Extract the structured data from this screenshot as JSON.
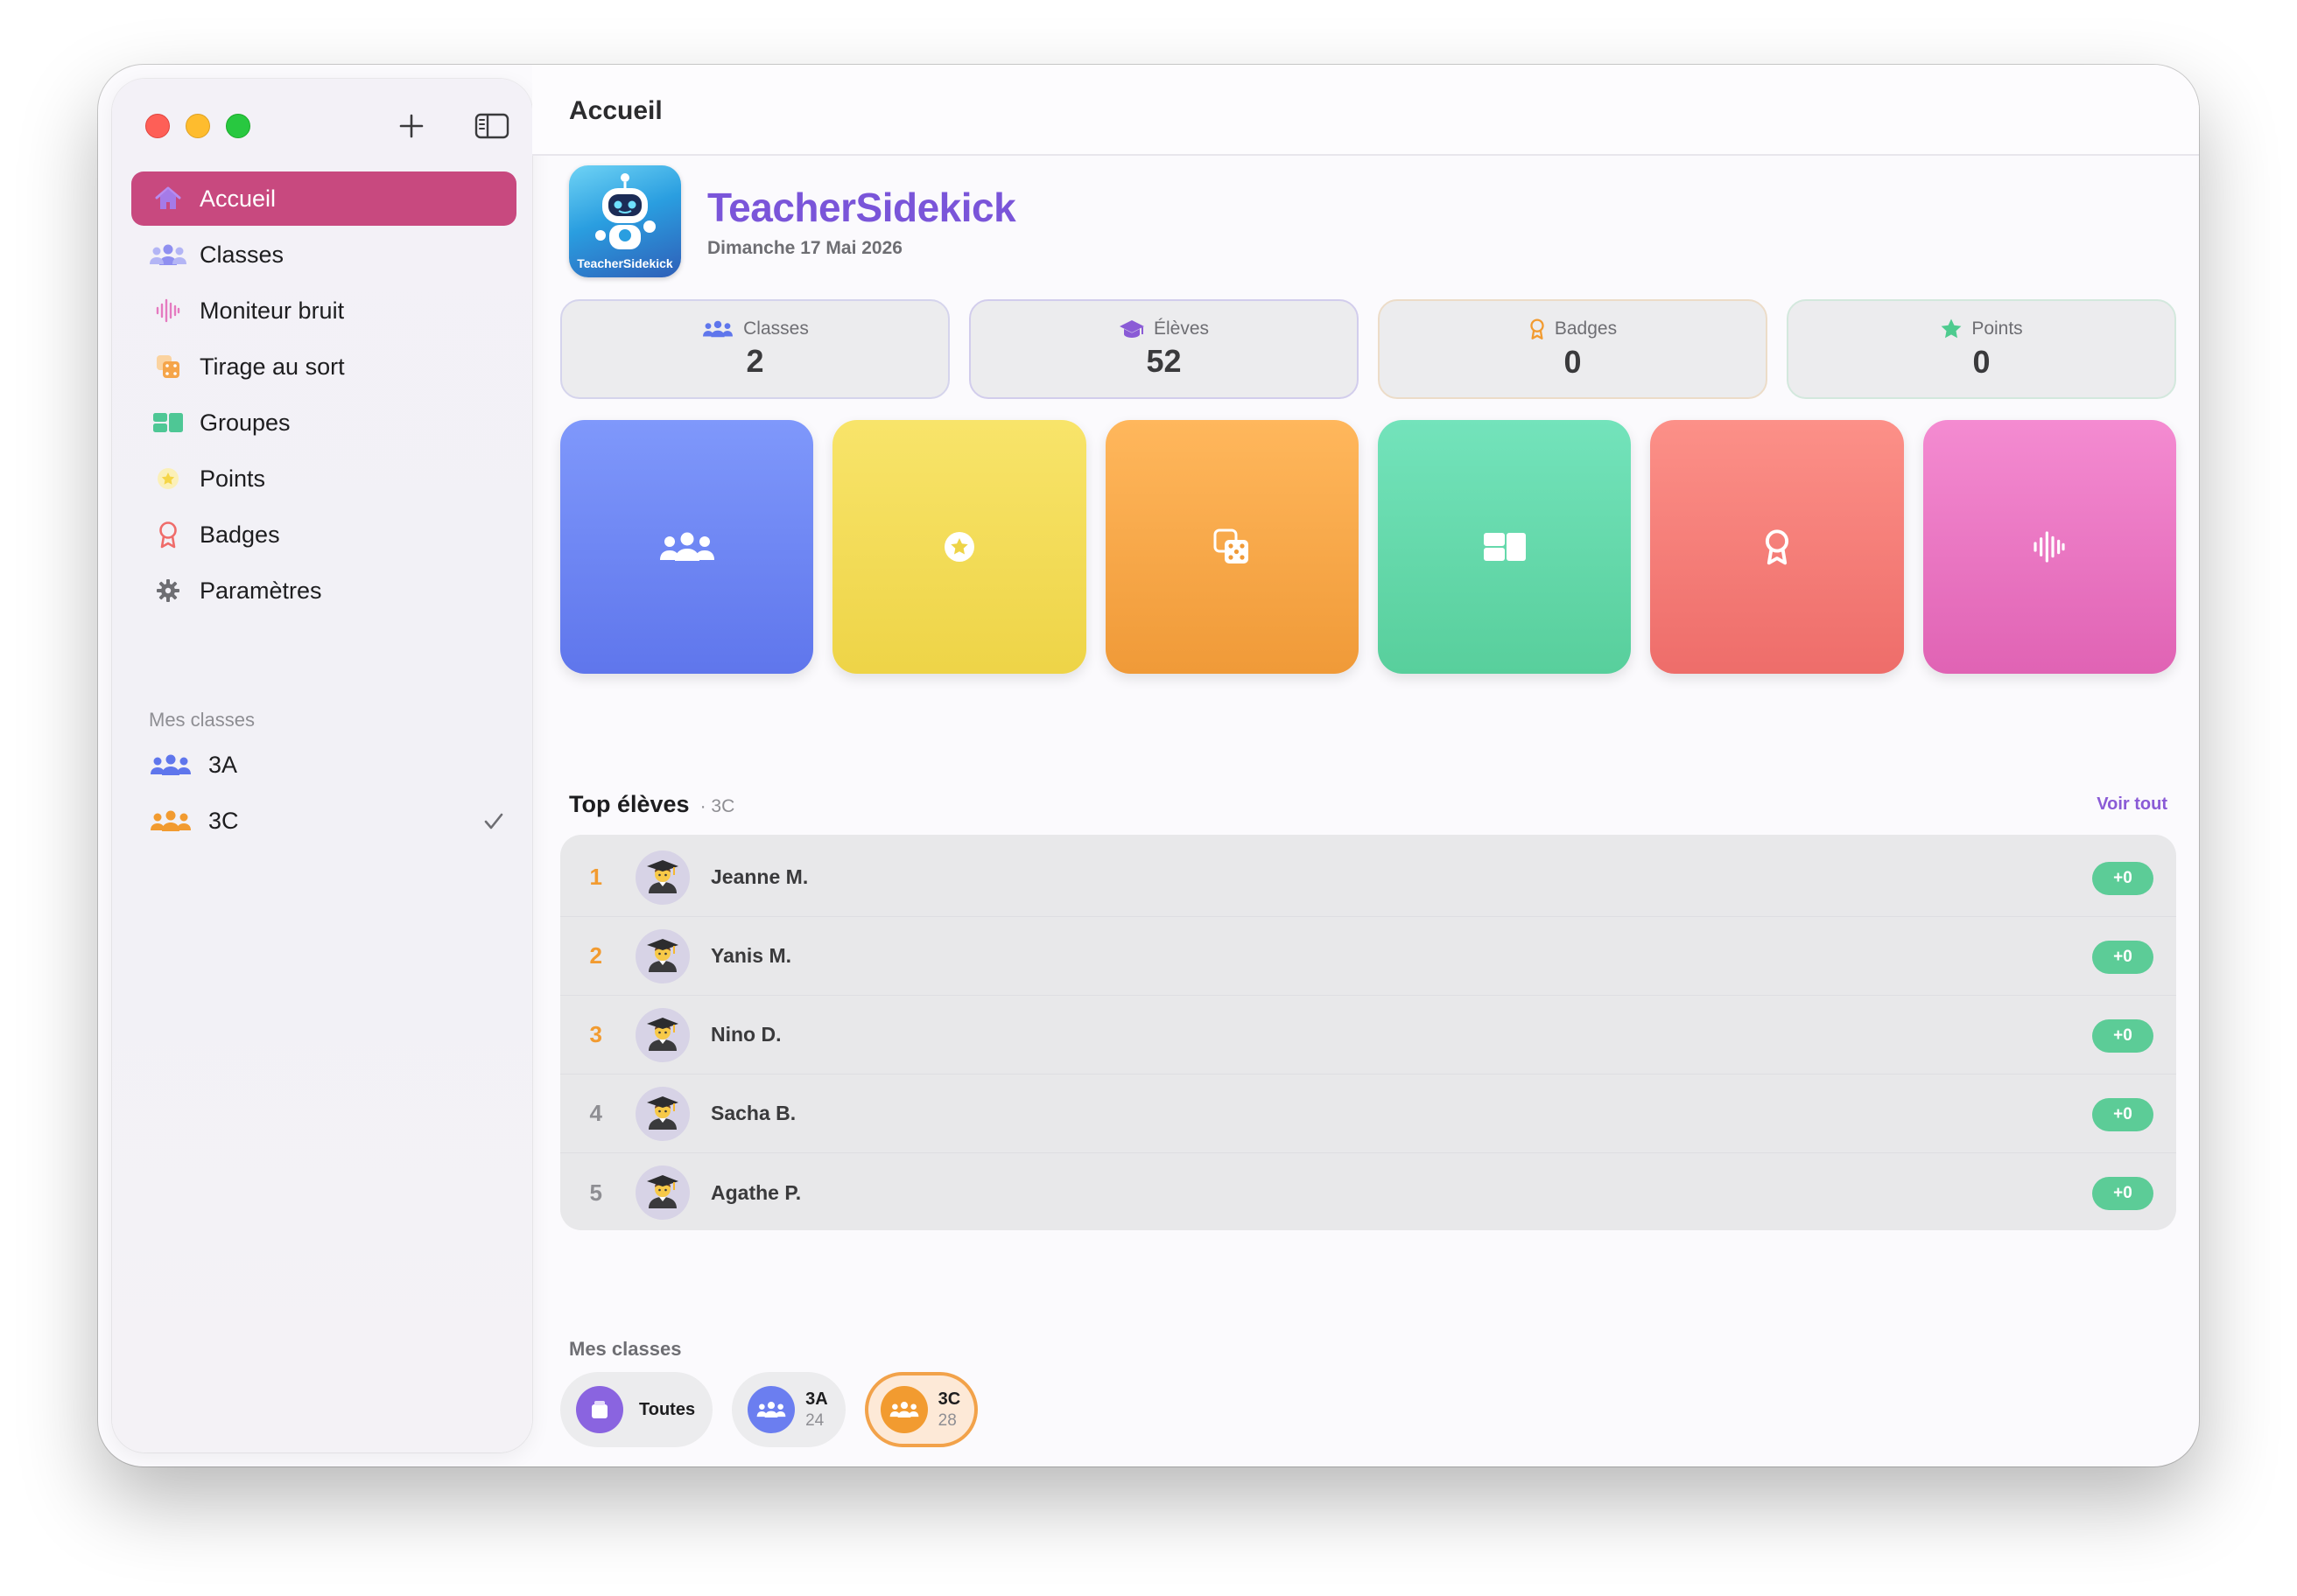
{
  "sidebar": {
    "nav": [
      {
        "label": "Accueil",
        "icon": "house-icon"
      },
      {
        "label": "Classes",
        "icon": "people-icon"
      },
      {
        "label": "Moniteur bruit",
        "icon": "waveform-icon"
      },
      {
        "label": "Tirage au sort",
        "icon": "dice-icon"
      },
      {
        "label": "Groupes",
        "icon": "groups-icon"
      },
      {
        "label": "Points",
        "icon": "star-icon"
      },
      {
        "label": "Badges",
        "icon": "rosette-icon"
      },
      {
        "label": "Paramètres",
        "icon": "gear-icon"
      }
    ],
    "section_title": "Mes classes",
    "classes": [
      {
        "label": "3A",
        "color": "#5f76ec"
      },
      {
        "label": "3C",
        "color": "#f29b30",
        "selected": true
      }
    ]
  },
  "titlebar": {
    "title": "Accueil"
  },
  "hero": {
    "app_name": "TeacherSidekick",
    "logo_text": "TeacherSidekick",
    "date": "Dimanche 17 Mai 2026"
  },
  "stats": [
    {
      "label": "Classes",
      "value": "2",
      "icon": "people-icon",
      "color": "#5f76ec"
    },
    {
      "label": "Élèves",
      "value": "52",
      "icon": "graduation-cap-icon",
      "color": "#8a5bd6"
    },
    {
      "label": "Badges",
      "value": "0",
      "icon": "rosette-icon",
      "color": "#f29b30"
    },
    {
      "label": "Points",
      "value": "0",
      "icon": "star-icon",
      "color": "#4ecb8f"
    }
  ],
  "tiles": [
    {
      "icon": "people-icon"
    },
    {
      "icon": "star-icon"
    },
    {
      "icon": "dice-icon"
    },
    {
      "icon": "groups-icon"
    },
    {
      "icon": "rosette-icon"
    },
    {
      "icon": "waveform-icon"
    }
  ],
  "top_students": {
    "title": "Top élèves",
    "class_tag": "· 3C",
    "see_all": "Voir tout",
    "rows": [
      {
        "rank": "1",
        "name": "Jeanne M.",
        "points": "+0"
      },
      {
        "rank": "2",
        "name": "Yanis M.",
        "points": "+0"
      },
      {
        "rank": "3",
        "name": "Nino D.",
        "points": "+0"
      },
      {
        "rank": "4",
        "name": "Sacha B.",
        "points": "+0"
      },
      {
        "rank": "5",
        "name": "Agathe P.",
        "points": "+0"
      }
    ]
  },
  "my_classes": {
    "title": "Mes classes",
    "all_label": "Toutes",
    "chips": [
      {
        "name": "3A",
        "count": "24",
        "color": "#6b7ef0"
      },
      {
        "name": "3C",
        "count": "28",
        "color": "#f29b30",
        "selected": true
      }
    ]
  },
  "colors": {
    "accent": "#c8497f",
    "brand": "#7a55d9",
    "points_badge": "#5ccc97"
  }
}
